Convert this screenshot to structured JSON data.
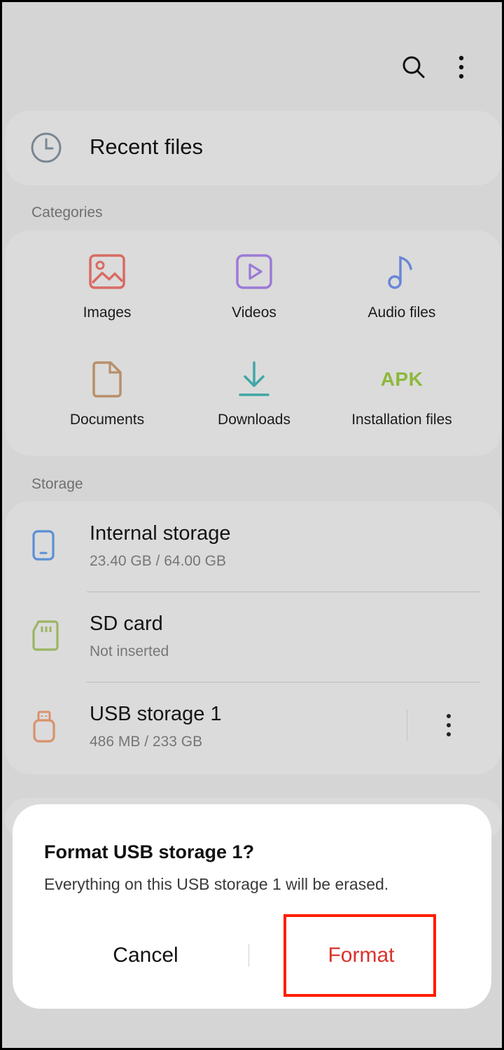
{
  "toolbar": {
    "search_icon": "search-icon",
    "more_icon": "more-vertical-icon"
  },
  "recent": {
    "label": "Recent files",
    "icon": "clock-icon"
  },
  "categories": {
    "title": "Categories",
    "items": [
      {
        "label": "Images",
        "icon": "image-icon",
        "color": "#d96b63"
      },
      {
        "label": "Videos",
        "icon": "video-play-icon",
        "color": "#9b7ad6"
      },
      {
        "label": "Audio files",
        "icon": "music-note-icon",
        "color": "#6a86d6"
      },
      {
        "label": "Documents",
        "icon": "document-icon",
        "color": "#b8906b"
      },
      {
        "label": "Downloads",
        "icon": "download-icon",
        "color": "#3fa6a6"
      },
      {
        "label": "Installation files",
        "icon": "apk-icon",
        "badge": "APK",
        "color": "#8cb83a"
      }
    ]
  },
  "storage": {
    "title": "Storage",
    "items": [
      {
        "name": "Internal storage",
        "detail": "23.40 GB / 64.00 GB",
        "icon": "phone-icon",
        "color": "#5b8fd6"
      },
      {
        "name": "SD card",
        "detail": "Not inserted",
        "icon": "sd-card-icon",
        "color": "#9cb563"
      },
      {
        "name": "USB storage 1",
        "detail": "486 MB / 233 GB",
        "icon": "usb-drive-icon",
        "color": "#d9916b"
      }
    ]
  },
  "dialog": {
    "title": "Format USB storage 1?",
    "message": "Everything on this USB storage 1 will be erased.",
    "cancel_label": "Cancel",
    "format_label": "Format",
    "highlight_color": "#ff1d00"
  }
}
